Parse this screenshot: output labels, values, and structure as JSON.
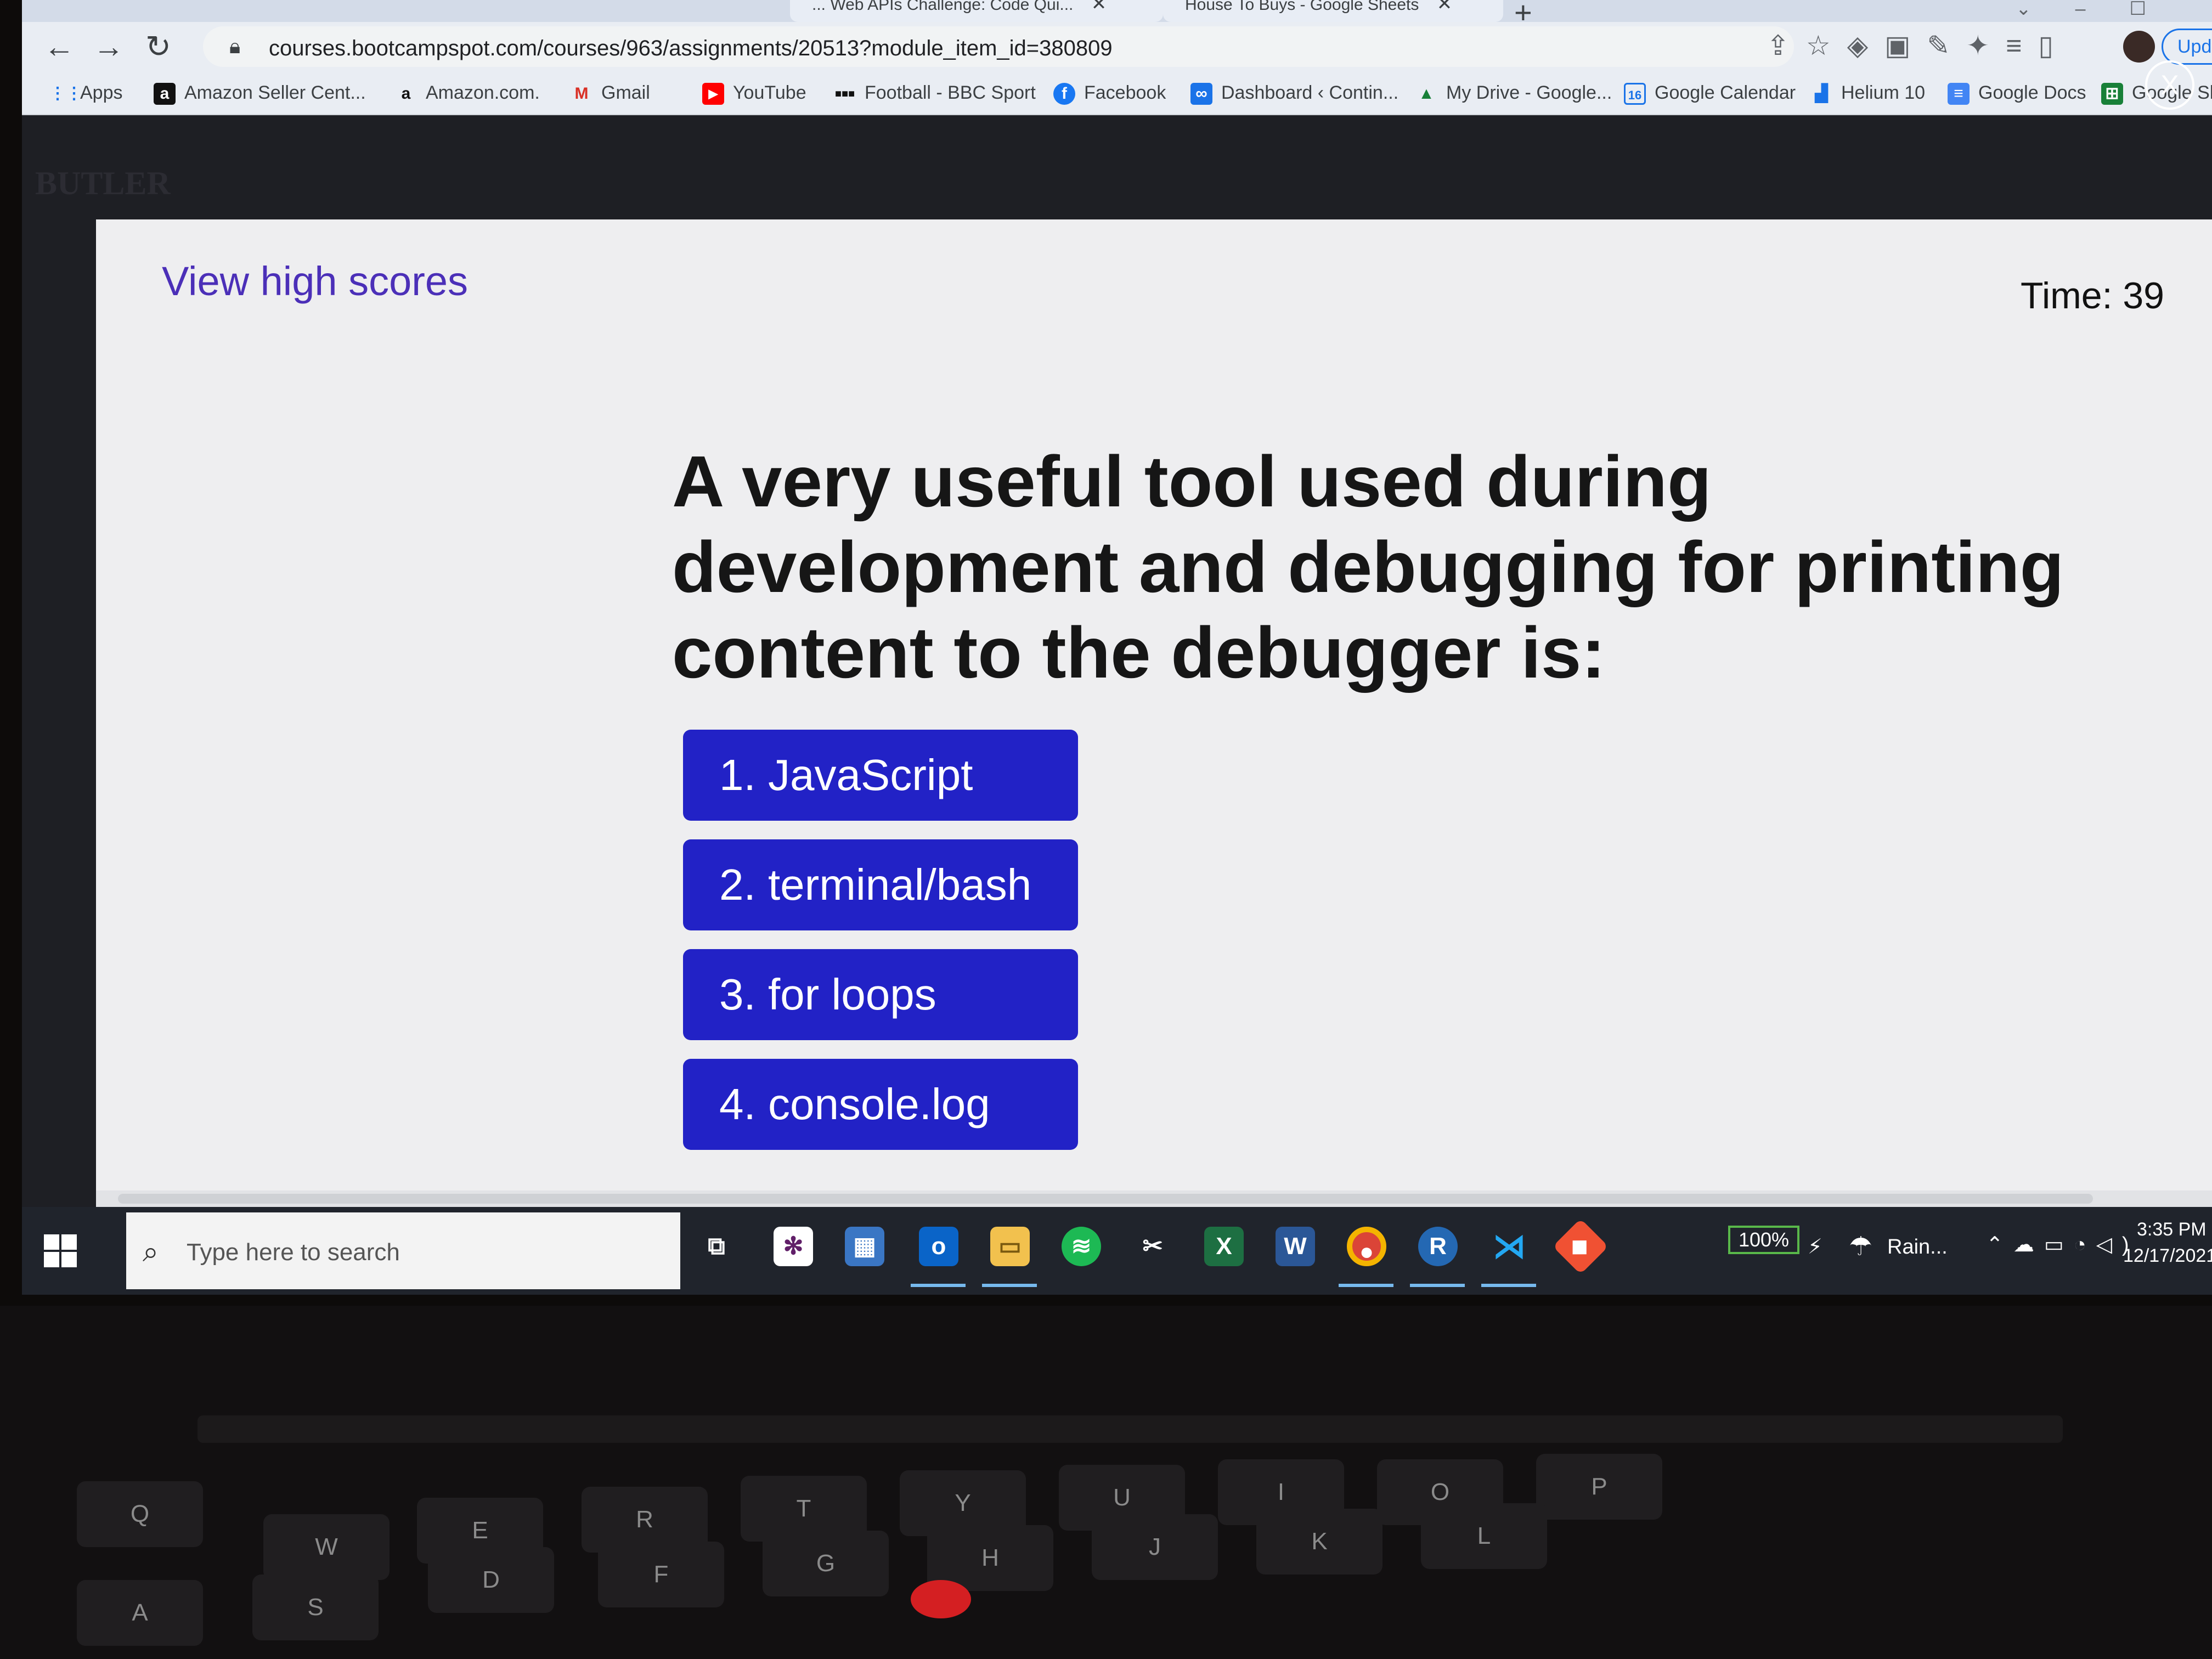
{
  "browser": {
    "tabs": [
      {
        "title": "... Web APIs Challenge: Code Qui..."
      },
      {
        "title": "House To Buys - Google Sheets"
      }
    ],
    "url": "courses.bootcampspot.com/courses/963/assignments/20513?module_item_id=380809",
    "update_label": "Upda",
    "bookmarks": [
      {
        "label": "Apps",
        "icon": "apps-grid-icon",
        "color": "#1a73e8"
      },
      {
        "label": "Amazon Seller Cent...",
        "icon": "amazon-icon",
        "color": "#111111"
      },
      {
        "label": "Amazon.com.",
        "icon": "amazon-icon",
        "color": "#111111"
      },
      {
        "label": "Gmail",
        "icon": "gmail-icon",
        "color": "#d93025"
      },
      {
        "label": "YouTube",
        "icon": "youtube-icon",
        "color": "#ff0000"
      },
      {
        "label": "Football - BBC Sport",
        "icon": "bbc-icon",
        "color": "#111111"
      },
      {
        "label": "Facebook",
        "icon": "facebook-icon",
        "color": "#1877f2"
      },
      {
        "label": "Dashboard ‹ Contin...",
        "icon": "dashboard-icon",
        "color": "#1a73e8"
      },
      {
        "label": "My Drive - Google...",
        "icon": "google-drive-icon",
        "color": "#188038"
      },
      {
        "label": "Google Calendar",
        "icon": "google-calendar-icon",
        "color": "#1a73e8"
      },
      {
        "label": "Helium 10",
        "icon": "helium-icon",
        "color": "#1a73e8"
      },
      {
        "label": "Google Docs",
        "icon": "google-docs-icon",
        "color": "#4285f4"
      },
      {
        "label": "Google Sheets",
        "icon": "google-sheets-icon",
        "color": "#188038"
      }
    ]
  },
  "quiz": {
    "view_high_scores": "View high scores",
    "timer": "Time: 39",
    "question": "A very useful tool used during development and debugging for printing content to the debugger is:",
    "answers": [
      "1.  JavaScript",
      "2. terminal/bash",
      "3. for loops",
      "4. console.log"
    ],
    "close_label": "X",
    "accent": "#2222c6",
    "link_color": "#4b2fb8"
  },
  "taskbar": {
    "search_placeholder": "Type here to search",
    "battery": "100%",
    "weather": "Rain...",
    "time": "3:35 PM",
    "date": "12/17/2021",
    "apps": [
      {
        "name": "task-view-icon"
      },
      {
        "name": "slack-icon"
      },
      {
        "name": "calculator-icon"
      },
      {
        "name": "outlook-icon"
      },
      {
        "name": "file-explorer-icon"
      },
      {
        "name": "spotify-icon"
      },
      {
        "name": "snipping-tool-icon"
      },
      {
        "name": "excel-icon"
      },
      {
        "name": "word-icon"
      },
      {
        "name": "chrome-icon"
      },
      {
        "name": "r-icon"
      },
      {
        "name": "vscode-icon"
      },
      {
        "name": "git-icon"
      }
    ]
  }
}
